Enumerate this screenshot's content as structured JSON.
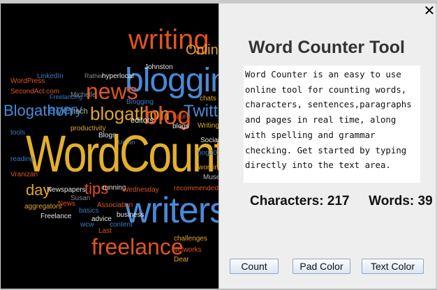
{
  "app": {
    "title": "Word Counter Tool",
    "description_lines": [
      "Word Counter is an easy to use",
      "online tool for counting words,",
      "characters, sentences,paragraphs",
      "and pages in real time, along",
      "with spelling and grammar",
      "checking. Get started by typing",
      "directly into the text area."
    ],
    "stats": {
      "characters": "Characters: 217",
      "words": "Words: 39"
    },
    "buttons": {
      "count": "Count",
      "pad_color": "Pad Color",
      "text_color": "Text Color"
    },
    "close_icon": "close-icon"
  },
  "word_cloud": {
    "words": [
      {
        "text": "writing",
        "color": "#e0541f"
      },
      {
        "text": "Online",
        "color": "#e3a52c"
      },
      {
        "text": "blogging",
        "color": "#4a8ad6"
      },
      {
        "text": "news",
        "color": "#e0541f"
      },
      {
        "text": "WordPress",
        "color": "#e0541f"
      },
      {
        "text": "SecondAct.com",
        "color": "#e0541f"
      },
      {
        "text": "LinkedIn",
        "color": "#3a78c0"
      },
      {
        "text": "Rather",
        "color": "#888888"
      },
      {
        "text": "hyperlocal",
        "color": "#e8e8e8"
      },
      {
        "text": "Johnston",
        "color": "#e8e8e8"
      },
      {
        "text": "Blogathon",
        "color": "#4a8ad6"
      },
      {
        "text": "every",
        "color": "#3a78c0"
      },
      {
        "text": "Freelancing",
        "color": "#3a78c0"
      },
      {
        "text": "Michelle",
        "color": "#888888"
      },
      {
        "text": "tech",
        "color": "#bbbbbb"
      },
      {
        "text": "blogathon",
        "color": "#e3a52c"
      },
      {
        "text": "Blogging",
        "color": "#3a78c0"
      },
      {
        "text": "blog",
        "color": "#e0541f"
      },
      {
        "text": "chats",
        "color": "#e3a52c"
      },
      {
        "text": "Twitter",
        "color": "#4a8ad6"
      },
      {
        "text": "future",
        "color": "#e0541f"
      },
      {
        "text": "editors",
        "color": "#e8e8e8"
      },
      {
        "text": "blogs",
        "color": "#e8e8e8"
      },
      {
        "text": "Writing",
        "color": "#e3a52c"
      },
      {
        "text": "productivity",
        "color": "#e3a52c"
      },
      {
        "text": "tools",
        "color": "#3a78c0"
      },
      {
        "text": "Blogs",
        "color": "#e8e8e8"
      },
      {
        "text": "Urban",
        "color": "#3a78c0"
      },
      {
        "text": "Social",
        "color": "#e8e8e8"
      },
      {
        "text": "WordCount",
        "color": "#e3b02c"
      },
      {
        "text": "reading",
        "color": "#3a78c0"
      },
      {
        "text": "bog201",
        "color": "#3a78c0"
      },
      {
        "text": "Vranizan",
        "color": "#e0541f"
      },
      {
        "text": "working",
        "color": "#e3a52c"
      },
      {
        "text": "Muse",
        "color": "#bbbbbb"
      },
      {
        "text": "day",
        "color": "#e3a52c"
      },
      {
        "text": "Newspapers",
        "color": "#e8e8e8"
      },
      {
        "text": "Susan",
        "color": "#888888"
      },
      {
        "text": "tips",
        "color": "#e0541f"
      },
      {
        "text": "running",
        "color": "#e8e8e8"
      },
      {
        "text": "Wednesday",
        "color": "#e0541f"
      },
      {
        "text": "recommended",
        "color": "#e0541f"
      },
      {
        "text": "aggregators",
        "color": "#e3a52c"
      },
      {
        "text": "News",
        "color": "#e0541f"
      },
      {
        "text": "writers",
        "color": "#4a8ad6"
      },
      {
        "text": "basics",
        "color": "#3a78c0"
      },
      {
        "text": "Association",
        "color": "#e0541f"
      },
      {
        "text": "Freelance",
        "color": "#e8e8e8"
      },
      {
        "text": "advice",
        "color": "#e8e8e8"
      },
      {
        "text": "business",
        "color": "#e8e8e8"
      },
      {
        "text": "wcw",
        "color": "#3a78c0"
      },
      {
        "text": "content",
        "color": "#3a78c0"
      },
      {
        "text": "Last",
        "color": "#e0541f"
      },
      {
        "text": "challenges",
        "color": "#e3a52c"
      },
      {
        "text": "freelance",
        "color": "#e0541f"
      },
      {
        "text": "Networks",
        "color": "#e0541f"
      },
      {
        "text": "Dear",
        "color": "#e3a52c"
      }
    ]
  }
}
